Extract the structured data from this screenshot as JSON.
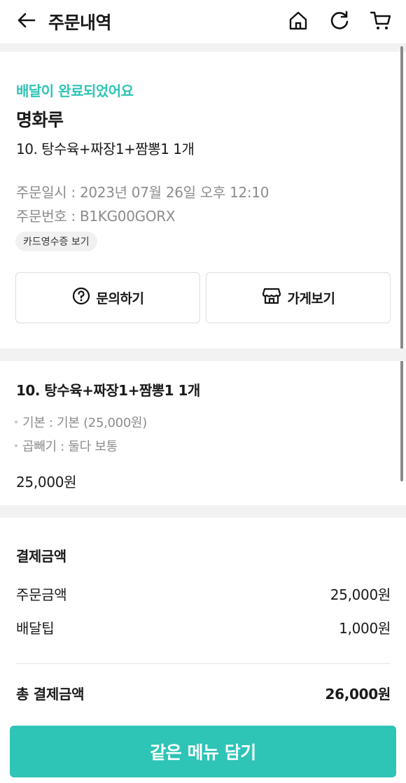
{
  "header": {
    "title": "주문내역",
    "icons": [
      "back-arrow-icon",
      "home-icon",
      "refresh-icon",
      "cart-icon"
    ]
  },
  "order": {
    "status": "배달이 완료되었어요",
    "store_name": "명화루",
    "title": "10. 탕수육+짜장1+짬뽕1 1개",
    "datetime": "주문일시 : 2023년 07월 26일 오후 12:10",
    "number": "주문번호 : B1KG00GORX",
    "receipt_label": "카드영수증 보기",
    "inquiry_label": "문의하기",
    "store_view_label": "가게보기"
  },
  "item": {
    "title": "10. 탕수육+짜장1+짬뽕1 1개",
    "options": [
      "기본 : 기본 (25,000원)",
      "곱빼기 : 둘다 보통"
    ],
    "price": "25,000원"
  },
  "payment": {
    "heading": "결제금액",
    "order_amount_label": "주문금액",
    "order_amount": "25,000원",
    "delivery_tip_label": "배달팁",
    "delivery_tip": "1,000원",
    "total_label": "총 결제금액",
    "total": "26,000원"
  },
  "cta_label": "같은 메뉴 담기",
  "colors": {
    "accent": "#2ec4b6",
    "separator": "#f2f2f3",
    "muted_text": "#8c8c8c"
  }
}
